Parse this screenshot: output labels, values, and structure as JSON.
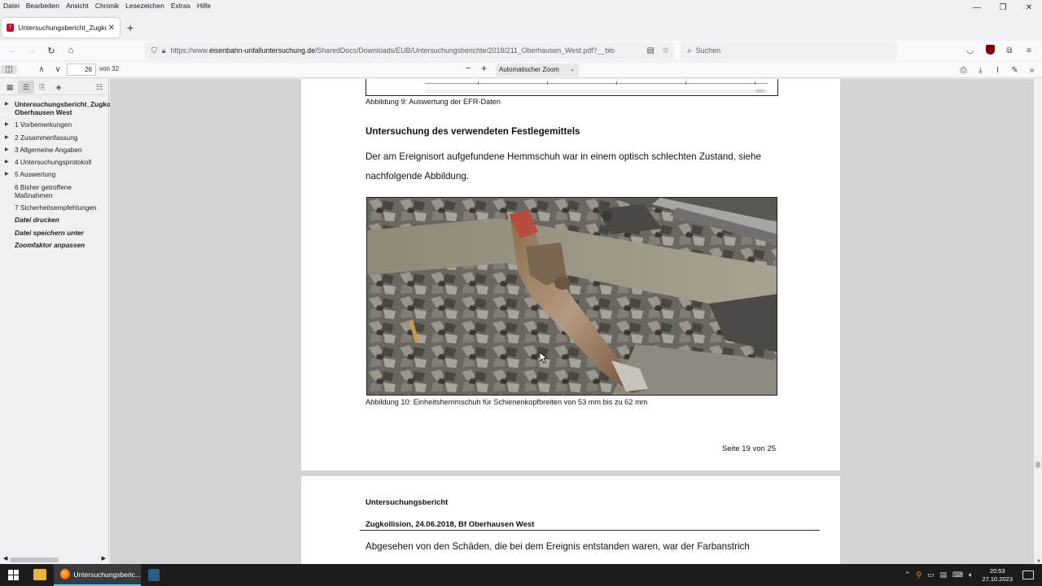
{
  "menubar": [
    "Datei",
    "Bearbeiten",
    "Ansicht",
    "Chronik",
    "Lesezeichen",
    "Extras",
    "Hilfe"
  ],
  "tab": {
    "title": "Untersuchungsbericht_Zugkollisi"
  },
  "url": {
    "prefix": "https://www.",
    "domain": "eisenbahn-unfalluntersuchung.de",
    "path": "/SharedDocs/Downloads/EUB/Untersuchungsberichte/2018/211_Oberhausen_West.pdf?__blo"
  },
  "search": {
    "placeholder": "Suchen"
  },
  "pdf_toolbar": {
    "page_current": "26",
    "page_total": "von 32",
    "zoom": "Automatischer Zoom"
  },
  "sidebar": {
    "items": [
      {
        "label": "Untersuchungsbericht_Zugkollision Oberhausen West",
        "expandable": true,
        "style": "bold"
      },
      {
        "label": "1 Vorbemerkungen",
        "expandable": true,
        "style": "normal"
      },
      {
        "label": "2 Zusammenfassung",
        "expandable": true,
        "style": "normal"
      },
      {
        "label": "3 Allgemeine Angaben",
        "expandable": true,
        "style": "normal"
      },
      {
        "label": "4 Untersuchungsprotokoll",
        "expandable": true,
        "style": "normal"
      },
      {
        "label": "5 Auswertung",
        "expandable": true,
        "style": "normal"
      },
      {
        "label": "6 Bisher getroffene Maßnahmen",
        "expandable": false,
        "style": "normal"
      },
      {
        "label": "7 Sicherheitsempfehlungen",
        "expandable": false,
        "style": "normal"
      },
      {
        "label": "Datei drucken",
        "expandable": false,
        "style": "italic"
      },
      {
        "label": "Datei speichern unter",
        "expandable": false,
        "style": "italic"
      },
      {
        "label": "Zoomfaktor anpassen",
        "expandable": false,
        "style": "italic"
      }
    ]
  },
  "document": {
    "caption_fig9": "Abbildung 9: Auswertung der EFR-Daten",
    "heading": "Untersuchung des verwendeten Festlegemittels",
    "paragraph_line1": "Der am Ereignisort aufgefundene Hemmschuh war in einem optisch schlechten Zustand, siehe",
    "paragraph_line2": "nachfolgende Abbildung.",
    "caption_fig10": "Abbildung 10: Einheitshemmschuh für Schienenkopfbreiten von 53 mm bis zu 62 mm",
    "page_footer": "Seite 19 von 25",
    "next_page": {
      "label1": "Untersuchungsbericht",
      "label2": "Zugkollision, 24.06.2018, Bf Oberhausen West",
      "text": "Abgesehen von den Schäden, die bei dem Ereignis entstanden waren, war der Farbanstrich"
    }
  },
  "taskbar": {
    "firefox_label": "Untersuchungsberic...",
    "time": "20:53",
    "date": "27.10.2023"
  },
  "colors": {
    "accent": "#60cdff",
    "ublock": "#800000"
  }
}
